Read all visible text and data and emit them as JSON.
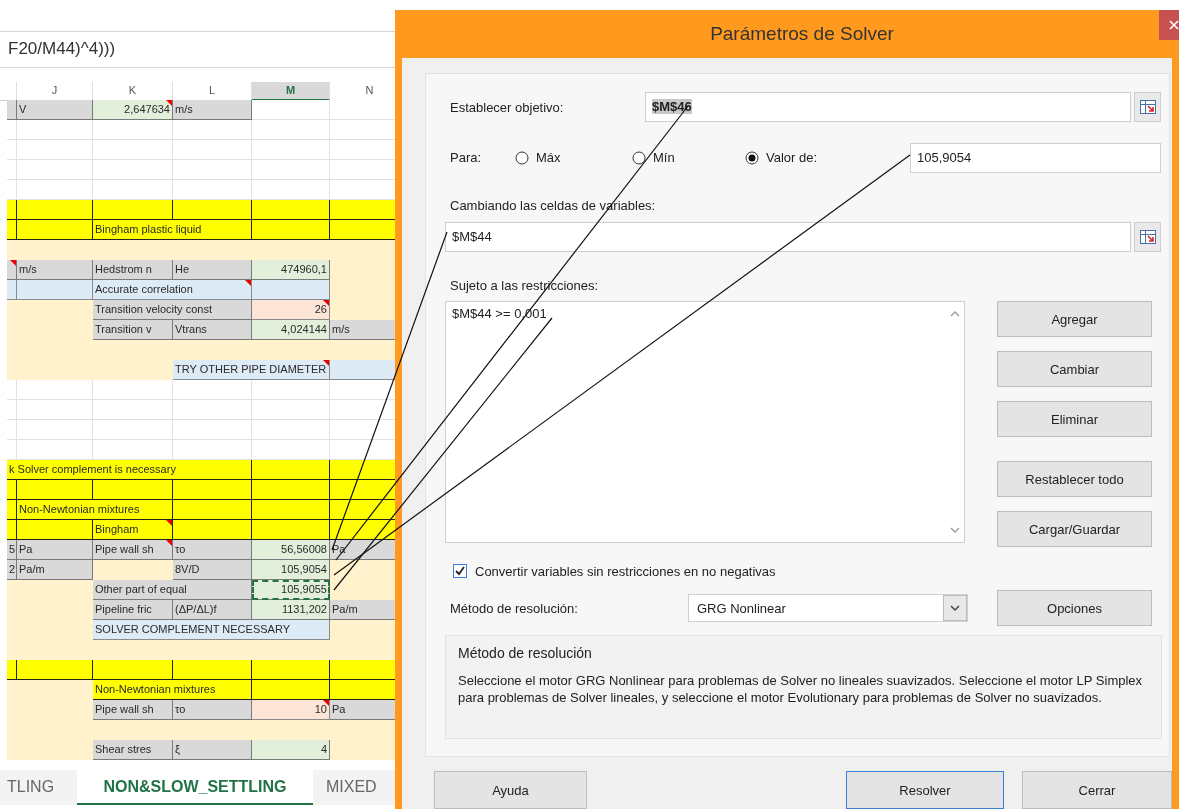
{
  "sheet": {
    "formula": "F20/M44)^4)))",
    "columns": [
      {
        "label": "J",
        "selected": false
      },
      {
        "label": "K",
        "selected": false
      },
      {
        "label": "L",
        "selected": false
      },
      {
        "label": "M",
        "selected": true
      },
      {
        "label": "N",
        "selected": false
      }
    ],
    "rows": [
      {
        "cells": [
          {
            "color": "#d9d9d9"
          },
          {
            "color": "#d9d9d9",
            "text": "V"
          },
          {
            "color": "#e2efda",
            "text": "2,647634",
            "kind": "number",
            "comment": true
          },
          {
            "color": "#d9d9d9",
            "text": "m/s"
          },
          {
            "color": "#ffffff"
          },
          {
            "color": "#ffffff"
          }
        ]
      },
      {
        "cells": [
          {
            "color": "#ffffff"
          },
          {
            "color": "#ffffff"
          },
          {
            "color": "#ffffff"
          },
          {
            "color": "#ffffff"
          },
          {
            "color": "#ffffff"
          },
          {
            "color": "#ffffff"
          }
        ]
      },
      {
        "cells": [
          {
            "color": "#ffffff"
          },
          {
            "color": "#ffffff"
          },
          {
            "color": "#ffffff"
          },
          {
            "color": "#ffffff"
          },
          {
            "color": "#ffffff"
          },
          {
            "color": "#ffffff"
          }
        ]
      },
      {
        "cells": [
          {
            "color": "#ffffff"
          },
          {
            "color": "#ffffff"
          },
          {
            "color": "#ffffff"
          },
          {
            "color": "#ffffff"
          },
          {
            "color": "#ffffff"
          },
          {
            "color": "#ffffff"
          }
        ]
      },
      {
        "cells": [
          {
            "color": "#ffffff"
          },
          {
            "color": "#ffffff"
          },
          {
            "color": "#ffffff"
          },
          {
            "color": "#ffffff"
          },
          {
            "color": "#ffffff"
          },
          {
            "color": "#ffffff"
          }
        ]
      },
      {
        "cells": [
          {
            "color": "#ffff00"
          },
          {
            "color": "#ffff00"
          },
          {
            "color": "#ffff00"
          },
          {
            "color": "#ffff00"
          },
          {
            "color": "#ffff00"
          },
          {
            "color": "#ffff00"
          }
        ]
      },
      {
        "cells": [
          {
            "color": "#ffff00"
          },
          {
            "color": "#ffff00"
          },
          {
            "color": "#ffff00",
            "text": "Bingham plastic liquid"
          },
          {
            "color": "#ffff00"
          },
          {
            "color": "#ffff00"
          },
          {
            "color": "#ffff00"
          }
        ]
      },
      {
        "cells": [
          {
            "color": "#fff2cc"
          },
          {
            "color": "#fff2cc"
          },
          {
            "color": "#fff2cc"
          },
          {
            "color": "#fff2cc"
          },
          {
            "color": "#fff2cc"
          },
          {
            "color": "#fff2cc"
          }
        ]
      },
      {
        "cells": [
          {
            "color": "#d9d9d9",
            "comment": true
          },
          {
            "color": "#d9d9d9",
            "text": "m/s"
          },
          {
            "color": "#d9d9d9",
            "text": "Hedstrom n"
          },
          {
            "color": "#d9d9d9",
            "text": "He"
          },
          {
            "color": "#e2efda",
            "text": "474960,1",
            "kind": "number"
          },
          {
            "color": "#fff2cc"
          }
        ]
      },
      {
        "cells": [
          {
            "color": "#ddebf7"
          },
          {
            "color": "#ddebf7"
          },
          {
            "color": "#ddebf7",
            "text": "Accurate correlation",
            "comment": true
          },
          {
            "color": "#ddebf7"
          },
          {
            "color": "#ddebf7"
          },
          {
            "color": "#fff2cc"
          }
        ]
      },
      {
        "cells": [
          {
            "color": "#fff2cc"
          },
          {
            "color": "#fff2cc"
          },
          {
            "color": "#d9d9d9",
            "text": "Transition velocity const"
          },
          {
            "color": "#d9d9d9"
          },
          {
            "color": "#fce4d6",
            "text": "26",
            "kind": "number",
            "comment": true
          },
          {
            "color": "#fff2cc"
          }
        ]
      },
      {
        "cells": [
          {
            "color": "#fff2cc"
          },
          {
            "color": "#fff2cc"
          },
          {
            "color": "#d9d9d9",
            "text": "Transition v"
          },
          {
            "color": "#d9d9d9",
            "text": "Vtrans"
          },
          {
            "color": "#e2efda",
            "text": "4,024144",
            "kind": "number"
          },
          {
            "color": "#d9d9d9",
            "text": "m/s"
          }
        ]
      },
      {
        "cells": [
          {
            "color": "#fff2cc"
          },
          {
            "color": "#fff2cc"
          },
          {
            "color": "#fff2cc"
          },
          {
            "color": "#fff2cc"
          },
          {
            "color": "#fff2cc"
          },
          {
            "color": "#fff2cc"
          }
        ]
      },
      {
        "cells": [
          {
            "color": "#fff2cc"
          },
          {
            "color": "#fff2cc"
          },
          {
            "color": "#fff2cc"
          },
          {
            "color": "#ddebf7",
            "text": "TRY OTHER PIPE DIAMETER",
            "comment": true
          },
          {
            "color": "#ddebf7"
          },
          {
            "color": "#ddebf7"
          }
        ]
      },
      {
        "cells": [
          {
            "color": "#ffffff"
          },
          {
            "color": "#ffffff"
          },
          {
            "color": "#ffffff"
          },
          {
            "color": "#ffffff"
          },
          {
            "color": "#ffffff"
          },
          {
            "color": "#ffffff"
          }
        ]
      },
      {
        "cells": [
          {
            "color": "#ffffff"
          },
          {
            "color": "#ffffff"
          },
          {
            "color": "#ffffff"
          },
          {
            "color": "#ffffff"
          },
          {
            "color": "#ffffff"
          },
          {
            "color": "#ffffff"
          }
        ]
      },
      {
        "cells": [
          {
            "color": "#ffffff"
          },
          {
            "color": "#ffffff"
          },
          {
            "color": "#ffffff"
          },
          {
            "color": "#ffffff"
          },
          {
            "color": "#ffffff"
          },
          {
            "color": "#ffffff"
          }
        ]
      },
      {
        "cells": [
          {
            "color": "#ffffff"
          },
          {
            "color": "#ffffff"
          },
          {
            "color": "#ffffff"
          },
          {
            "color": "#ffffff"
          },
          {
            "color": "#ffffff"
          },
          {
            "color": "#ffffff"
          }
        ]
      },
      {
        "cells": [
          {
            "color": "#ffff00",
            "text": "k Solver complement is necessary"
          },
          {
            "color": "#ffff00"
          },
          {
            "color": "#ffff00"
          },
          {
            "color": "#ffff00"
          },
          {
            "color": "#ffff00"
          },
          {
            "color": "#ffff00"
          }
        ]
      },
      {
        "cells": [
          {
            "color": "#ffff00"
          },
          {
            "color": "#ffff00"
          },
          {
            "color": "#ffff00"
          },
          {
            "color": "#ffff00"
          },
          {
            "color": "#ffff00"
          },
          {
            "color": "#ffff00"
          }
        ]
      },
      {
        "cells": [
          {
            "color": "#ffff00"
          },
          {
            "color": "#ffff00",
            "text": "Non-Newtonian mixtures"
          },
          {
            "color": "#ffff00"
          },
          {
            "color": "#ffff00"
          },
          {
            "color": "#ffff00"
          },
          {
            "color": "#ffff00"
          }
        ]
      },
      {
        "cells": [
          {
            "color": "#ffff00"
          },
          {
            "color": "#ffff00"
          },
          {
            "color": "#ffff00",
            "text": "Bingham",
            "comment": true
          },
          {
            "color": "#ffff00"
          },
          {
            "color": "#ffff00"
          },
          {
            "color": "#ffff00"
          }
        ]
      },
      {
        "cells": [
          {
            "color": "#d9d9d9",
            "text": "5",
            "kind": "number"
          },
          {
            "color": "#d9d9d9",
            "text": "Pa"
          },
          {
            "color": "#d9d9d9",
            "text": "Pipe wall sh",
            "comment": true
          },
          {
            "color": "#d9d9d9",
            "text": "τo"
          },
          {
            "color": "#e2efda",
            "text": "56,56008",
            "kind": "number"
          },
          {
            "color": "#d9d9d9",
            "text": "Pa"
          }
        ]
      },
      {
        "cells": [
          {
            "color": "#d9d9d9",
            "text": "2",
            "kind": "number"
          },
          {
            "color": "#d9d9d9",
            "text": "Pa/m"
          },
          {
            "color": "#fff2cc"
          },
          {
            "color": "#d9d9d9",
            "text": "8V/D"
          },
          {
            "color": "#e2efda",
            "text": "105,9054",
            "kind": "number"
          },
          {
            "color": "#fff2cc"
          }
        ]
      },
      {
        "cells": [
          {
            "color": "#fff2cc"
          },
          {
            "color": "#fff2cc"
          },
          {
            "color": "#d9d9d9",
            "text": "Other part of equal"
          },
          {
            "color": "#d9d9d9"
          },
          {
            "color": "#e2efda",
            "text": "105,9055",
            "kind": "number",
            "marquee": true
          },
          {
            "color": "#fff2cc"
          }
        ]
      },
      {
        "cells": [
          {
            "color": "#fff2cc"
          },
          {
            "color": "#fff2cc"
          },
          {
            "color": "#d9d9d9",
            "text": "Pipeline fric"
          },
          {
            "color": "#d9d9d9",
            "text": "(ΔP/ΔL)f"
          },
          {
            "color": "#e2efda",
            "text": "1131,202",
            "kind": "number"
          },
          {
            "color": "#d9d9d9",
            "text": "Pa/m"
          }
        ]
      },
      {
        "cells": [
          {
            "color": "#fff2cc"
          },
          {
            "color": "#fff2cc"
          },
          {
            "color": "#ddebf7",
            "text": "SOLVER COMPLEMENT NECESSARY"
          },
          {
            "color": "#ddebf7"
          },
          {
            "color": "#ddebf7"
          },
          {
            "color": "#fff2cc"
          }
        ]
      },
      {
        "cells": [
          {
            "color": "#fff2cc"
          },
          {
            "color": "#fff2cc"
          },
          {
            "color": "#fff2cc"
          },
          {
            "color": "#fff2cc"
          },
          {
            "color": "#fff2cc"
          },
          {
            "color": "#fff2cc"
          }
        ]
      },
      {
        "cells": [
          {
            "color": "#ffff00"
          },
          {
            "color": "#ffff00"
          },
          {
            "color": "#ffff00"
          },
          {
            "color": "#ffff00"
          },
          {
            "color": "#ffff00"
          },
          {
            "color": "#ffff00"
          }
        ]
      },
      {
        "cells": [
          {
            "color": "#fff2cc"
          },
          {
            "color": "#fff2cc"
          },
          {
            "color": "#ffff00",
            "text": "Non-Newtonian mixtures"
          },
          {
            "color": "#ffff00"
          },
          {
            "color": "#ffff00"
          },
          {
            "color": "#ffff00"
          }
        ]
      },
      {
        "cells": [
          {
            "color": "#fff2cc"
          },
          {
            "color": "#fff2cc"
          },
          {
            "color": "#d9d9d9",
            "text": "Pipe wall sh"
          },
          {
            "color": "#d9d9d9",
            "text": "τo"
          },
          {
            "color": "#fce4d6",
            "text": "10",
            "kind": "number",
            "comment": true
          },
          {
            "color": "#d9d9d9",
            "text": "Pa"
          }
        ]
      },
      {
        "cells": [
          {
            "color": "#fff2cc"
          },
          {
            "color": "#fff2cc"
          },
          {
            "color": "#fff2cc"
          },
          {
            "color": "#fff2cc"
          },
          {
            "color": "#fff2cc"
          },
          {
            "color": "#fff2cc"
          }
        ]
      },
      {
        "cells": [
          {
            "color": "#fff2cc"
          },
          {
            "color": "#fff2cc"
          },
          {
            "color": "#d9d9d9",
            "text": "Shear stres"
          },
          {
            "color": "#d9d9d9",
            "text": "ξ"
          },
          {
            "color": "#e2efda",
            "text": "4",
            "kind": "number"
          },
          {
            "color": "#fff2cc"
          }
        ]
      }
    ],
    "tabs": [
      {
        "label": "TLING",
        "selected": false
      },
      {
        "label": "NON&SLOW_SETTLING",
        "selected": true
      },
      {
        "label": "MIXED",
        "selected": false
      }
    ]
  },
  "dialog": {
    "title": "Parámetros de Solver",
    "objective": {
      "label": "Establecer objetivo:",
      "value": "$M$46",
      "highlighted": true
    },
    "to": {
      "label": "Para:",
      "options": [
        {
          "label": "Máx",
          "selected": false
        },
        {
          "label": "Mín",
          "selected": false
        },
        {
          "label": "Valor de:",
          "selected": true
        }
      ],
      "value": "105,9054"
    },
    "variables": {
      "label": "Cambiando las celdas de variables:",
      "value": "$M$44"
    },
    "constraints": {
      "label": "Sujeto a las restricciones:",
      "items": [
        "$M$44 >= 0,001"
      ]
    },
    "side_buttons": [
      "Agregar",
      "Cambiar",
      "Eliminar",
      "Restablecer todo",
      "Cargar/Guardar"
    ],
    "nonnegative": {
      "label": "Convertir variables sin restricciones en no negativas",
      "checked": true
    },
    "method": {
      "label": "Método de resolución:",
      "value": "GRG Nonlinear"
    },
    "options_button": "Opciones",
    "description": {
      "title": "Método de resolución",
      "text": "Seleccione el motor GRG Nonlinear para problemas de Solver no lineales suavizados. Seleccione el motor LP Simplex para problemas de Solver lineales, y seleccione el motor Evolutionary para problemas de Solver no suavizados."
    },
    "footer_buttons": [
      {
        "label": "Ayuda",
        "default": false
      },
      {
        "label": "Resolver",
        "default": true
      },
      {
        "label": "Cerrar",
        "default": false
      }
    ]
  }
}
